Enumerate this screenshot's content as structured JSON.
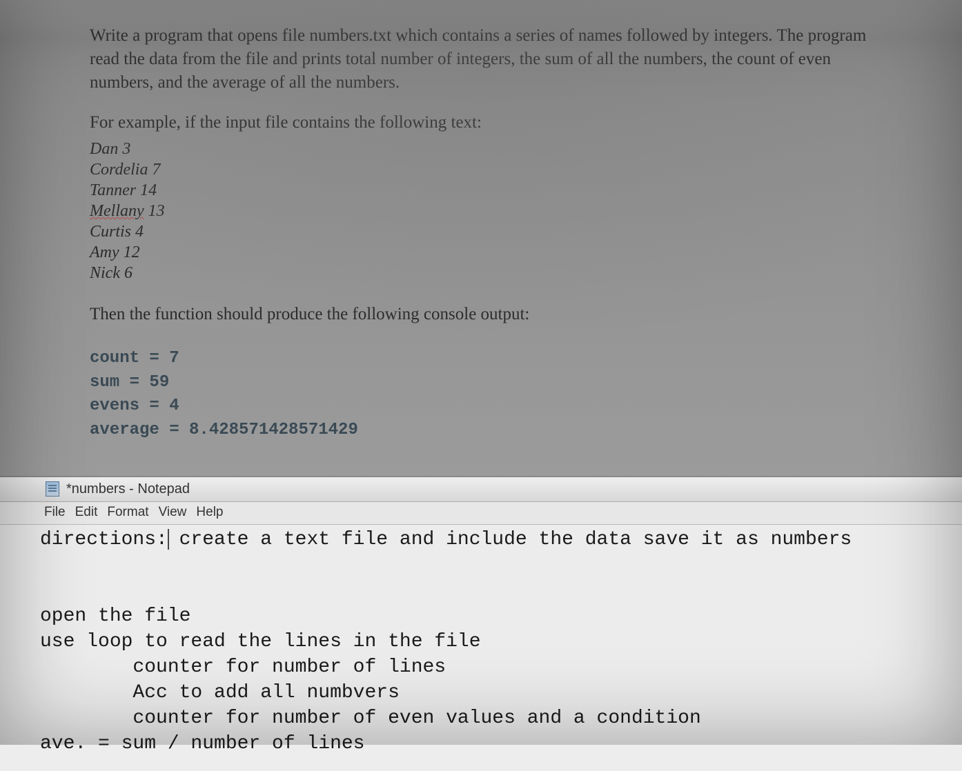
{
  "problem": {
    "description": "Write a program that opens file numbers.txt which contains a series of names followed by integers. The program read the data from the file and prints total number of integers, the sum of all the numbers, the count of even numbers, and the average of all the numbers.",
    "example_heading": "For example, if the input file contains the following text:",
    "file_lines": [
      {
        "name": "Dan",
        "value": "3",
        "underlined": false
      },
      {
        "name": "Cordelia",
        "value": "7",
        "underlined": false
      },
      {
        "name": "Tanner",
        "value": "14",
        "underlined": false
      },
      {
        "name": "Mellany",
        "value": "13",
        "underlined": true
      },
      {
        "name": "Curtis",
        "value": "4",
        "underlined": false
      },
      {
        "name": "Amy",
        "value": "12",
        "underlined": false
      },
      {
        "name": "Nick",
        "value": "6",
        "underlined": false
      }
    ],
    "output_heading": "Then the function should produce the following console output:",
    "console_lines": [
      "count =    7",
      "sum =   59",
      "evens =    4",
      "average =   8.428571428571429"
    ]
  },
  "notepad": {
    "title": "*numbers - Notepad",
    "menu": [
      "File",
      "Edit",
      "Format",
      "View",
      "Help"
    ],
    "content_lines": [
      "directions: create a text file and include the data save it as numbers",
      "",
      "",
      "open the file",
      "use loop to read the lines in the file",
      "        counter for number of lines",
      "        Acc to add all numbvers",
      "        counter for number of even values and a condition",
      "ave. = sum / number of lines"
    ],
    "cursor_position": {
      "line": 0,
      "col": 12
    }
  }
}
